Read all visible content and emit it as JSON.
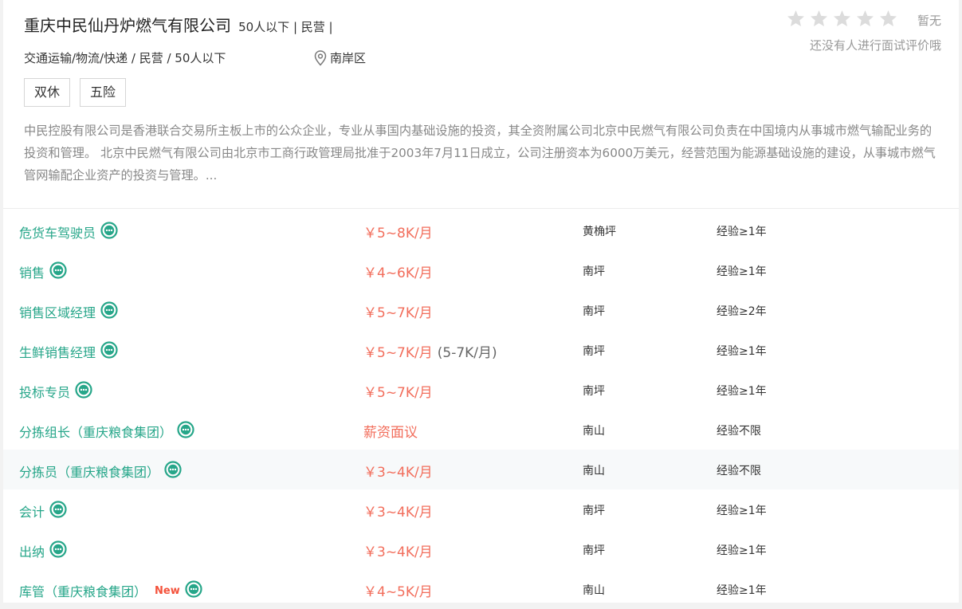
{
  "company": {
    "name": "重庆中民仙丹炉燃气有限公司",
    "meta": "50人以下 | 民营 |",
    "industry_line": "交通运输/物流/快递 / 民营 / 50人以下",
    "location": "南岸区",
    "tags": [
      "双休",
      "五险"
    ],
    "description": "中民控股有限公司是香港联合交易所主板上市的公众企业，专业从事国内基础设施的投资，其全资附属公司北京中民燃气有限公司负责在中国境内从事城市燃气输配业务的投资和管理。 北京中民燃气有限公司由北京市工商行政管理局批准于2003年7月11日成立，公司注册资本为6000万美元，经营范围为能源基础设施的建设，从事城市燃气管网输配企业资产的投资与管理。..."
  },
  "rating": {
    "stars_filled": 0,
    "stars_total": 5,
    "state": "暂无",
    "note": "还没有人进行面试评价哦"
  },
  "colors": {
    "job_link": "#26a689",
    "salary": "#f26d5b",
    "new_badge": "#f4523b",
    "star_empty": "#dcdcdc"
  },
  "jobs": [
    {
      "title": "危货车驾驶员",
      "salary": "￥5~8K/月",
      "salary_note": "",
      "area": "黄桷坪",
      "exp": "经验≥1年",
      "new": ""
    },
    {
      "title": "销售",
      "salary": "￥4~6K/月",
      "salary_note": "",
      "area": "南坪",
      "exp": "经验≥1年",
      "new": ""
    },
    {
      "title": "销售区域经理",
      "salary": "￥5~7K/月",
      "salary_note": "",
      "area": "南坪",
      "exp": "经验≥2年",
      "new": ""
    },
    {
      "title": "生鲜销售经理",
      "salary": "￥5~7K/月",
      "salary_note": "(5-7K/月)",
      "area": "南坪",
      "exp": "经验≥1年",
      "new": ""
    },
    {
      "title": "投标专员",
      "salary": "￥5~7K/月",
      "salary_note": "",
      "area": "南坪",
      "exp": "经验≥1年",
      "new": ""
    },
    {
      "title": "分拣组长（重庆粮食集团）",
      "salary": "薪资面议",
      "salary_note": "",
      "area": "南山",
      "exp": "经验不限",
      "new": ""
    },
    {
      "title": "分拣员（重庆粮食集团）",
      "salary": "￥3~4K/月",
      "salary_note": "",
      "area": "南山",
      "exp": "经验不限",
      "new": ""
    },
    {
      "title": "会计",
      "salary": "￥3~4K/月",
      "salary_note": "",
      "area": "南坪",
      "exp": "经验≥1年",
      "new": ""
    },
    {
      "title": "出纳",
      "salary": "￥3~4K/月",
      "salary_note": "",
      "area": "南坪",
      "exp": "经验≥1年",
      "new": ""
    },
    {
      "title": "库管（重庆粮食集团）",
      "salary": "￥4~5K/月",
      "salary_note": "",
      "area": "南山",
      "exp": "经验≥1年",
      "new": "New"
    }
  ]
}
